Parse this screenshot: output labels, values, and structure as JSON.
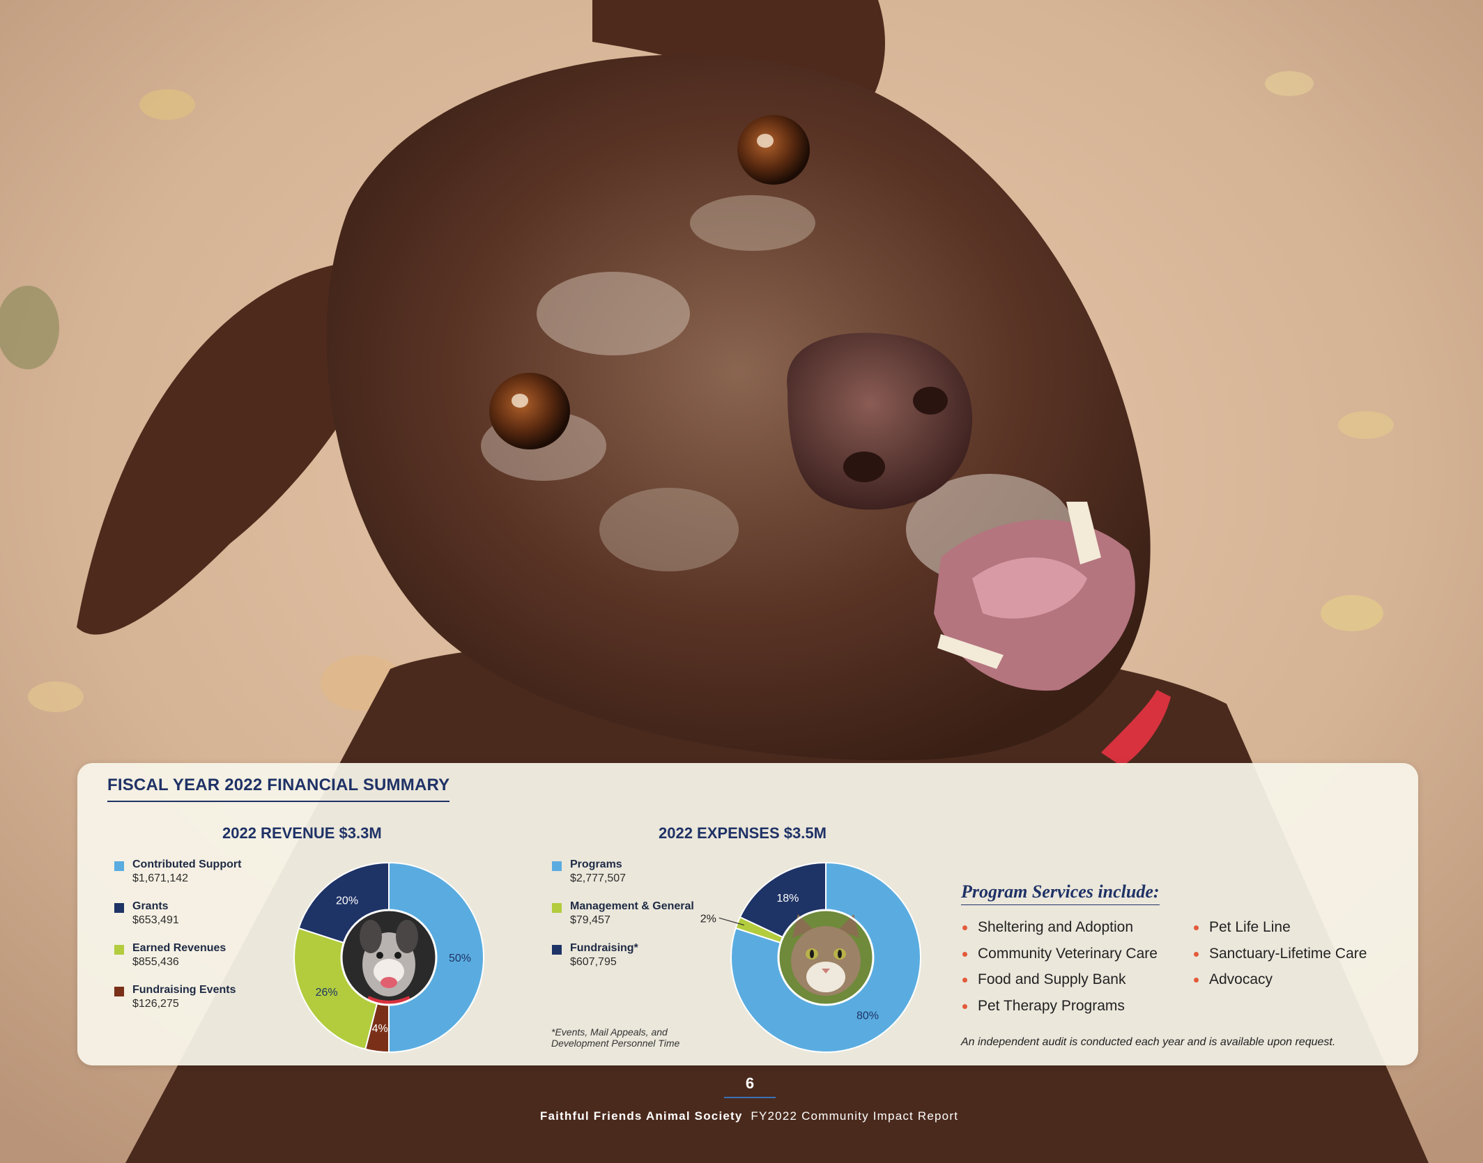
{
  "panel": {
    "title": "FISCAL YEAR 2022 FINANCIAL SUMMARY"
  },
  "revenue": {
    "title": "2022 REVENUE $3.3M",
    "legend": [
      {
        "label": "Contributed Support",
        "value": "$1,671,142",
        "color": "#5aace0"
      },
      {
        "label": "Grants",
        "value": "$653,491",
        "color": "#1e3366"
      },
      {
        "label": "Earned Revenues",
        "value": "$855,436",
        "color": "#b2cc3d"
      },
      {
        "label": "Fundraising Events",
        "value": "$126,275",
        "color": "#7a3018"
      }
    ]
  },
  "expenses": {
    "title": "2022 EXPENSES $3.5M",
    "legend": [
      {
        "label": "Programs",
        "value": "$2,777,507",
        "color": "#5aace0"
      },
      {
        "label": "Management & General",
        "value": "$79,457",
        "color": "#b2cc3d"
      },
      {
        "label": "Fundraising*",
        "value": "$607,795",
        "color": "#1e3366"
      }
    ],
    "footnote_line1": "*Events, Mail Appeals, and",
    "footnote_line2": " Development Personnel Time"
  },
  "chart_data": [
    {
      "type": "pie",
      "title": "2022 REVENUE $3.3M",
      "categories": [
        "Contributed Support",
        "Fundraising Events",
        "Earned Revenues",
        "Grants"
      ],
      "values": [
        50,
        4,
        26,
        20
      ],
      "labels": [
        "50%",
        "4%",
        "26%",
        "20%"
      ],
      "colors": [
        "#5aace0",
        "#7a3018",
        "#b2cc3d",
        "#1e3366"
      ],
      "label_colors": [
        "#1e3366",
        "#ffffff",
        "#1e3366",
        "#ffffff"
      ],
      "center_image": "dog-photo"
    },
    {
      "type": "pie",
      "title": "2022 EXPENSES $3.5M",
      "categories": [
        "Programs",
        "Management & General",
        "Fundraising*"
      ],
      "values": [
        80,
        2,
        18
      ],
      "labels": [
        "80%",
        "2%",
        "18%"
      ],
      "colors": [
        "#5aace0",
        "#b2cc3d",
        "#1e3366"
      ],
      "label_colors": [
        "#1e3366",
        "#1e3366",
        "#ffffff"
      ],
      "center_image": "cat-photo"
    }
  ],
  "services": {
    "title": "Program Services include:",
    "col1": [
      "Sheltering and Adoption",
      "Community Veterinary Care",
      "Food and Supply Bank",
      "Pet Therapy Programs"
    ],
    "col2": [
      "Pet Life Line",
      "Sanctuary-Lifetime Care",
      "Advocacy"
    ],
    "audit": "An independent audit is conducted each year and is available upon request."
  },
  "footer": {
    "page_number": "6",
    "org": "Faithful Friends Animal Society",
    "report": "FY2022 Community Impact Report"
  },
  "background": {
    "subject": "dog-photo",
    "colors": {
      "sand": "#d9b79a",
      "coat": "#5a3424",
      "collar": "#d8323f"
    }
  }
}
